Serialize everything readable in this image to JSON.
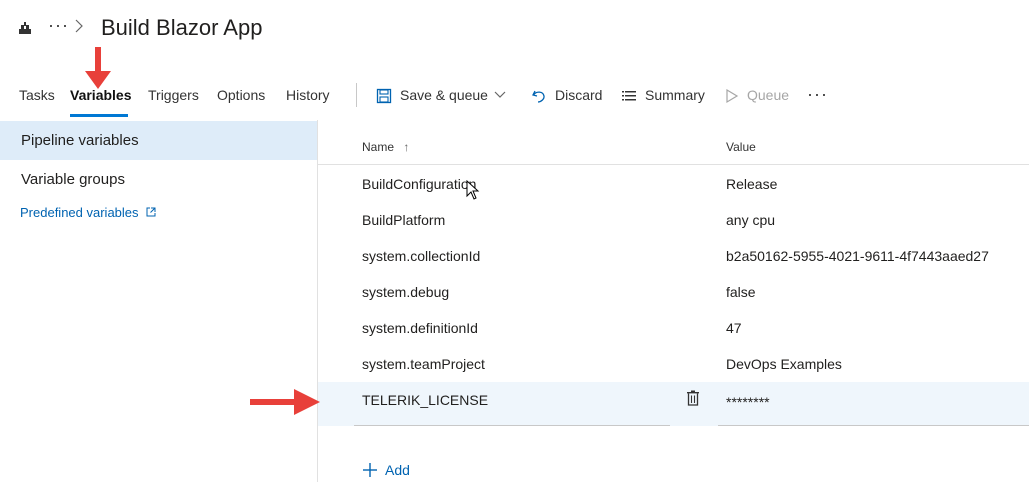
{
  "header": {
    "title": "Build Blazor App",
    "more_label": "···",
    "pipeline_icon": "pipeline-icon"
  },
  "tabs": [
    {
      "label": "Tasks"
    },
    {
      "label": "Variables"
    },
    {
      "label": "Triggers"
    },
    {
      "label": "Options"
    },
    {
      "label": "History"
    }
  ],
  "toolbar": {
    "save_queue_label": "Save & queue",
    "discard_label": "Discard",
    "summary_label": "Summary",
    "queue_label": "Queue",
    "more_label": "···"
  },
  "sidebar": {
    "items": [
      {
        "label": "Pipeline variables",
        "selected": true
      },
      {
        "label": "Variable groups",
        "selected": false
      }
    ],
    "predefined_link": "Predefined variables"
  },
  "grid": {
    "columns": {
      "name": "Name",
      "value": "Value"
    },
    "sort_indicator": "↑",
    "rows": [
      {
        "name": "BuildConfiguration",
        "value": "Release"
      },
      {
        "name": "BuildPlatform",
        "value": "any cpu"
      },
      {
        "name": "system.collectionId",
        "value": "b2a50162-5955-4021-9611-4f7443aaed27"
      },
      {
        "name": "system.debug",
        "value": "false"
      },
      {
        "name": "system.definitionId",
        "value": "47"
      },
      {
        "name": "system.teamProject",
        "value": "DevOps Examples"
      },
      {
        "name": "TELERIK_LICENSE",
        "value": "********"
      }
    ],
    "add_label": "Add"
  },
  "colors": {
    "accent": "#0078d4",
    "link": "#0063b1",
    "selected_bg": "#deecf9",
    "annotation_arrow": "#e8403a"
  }
}
